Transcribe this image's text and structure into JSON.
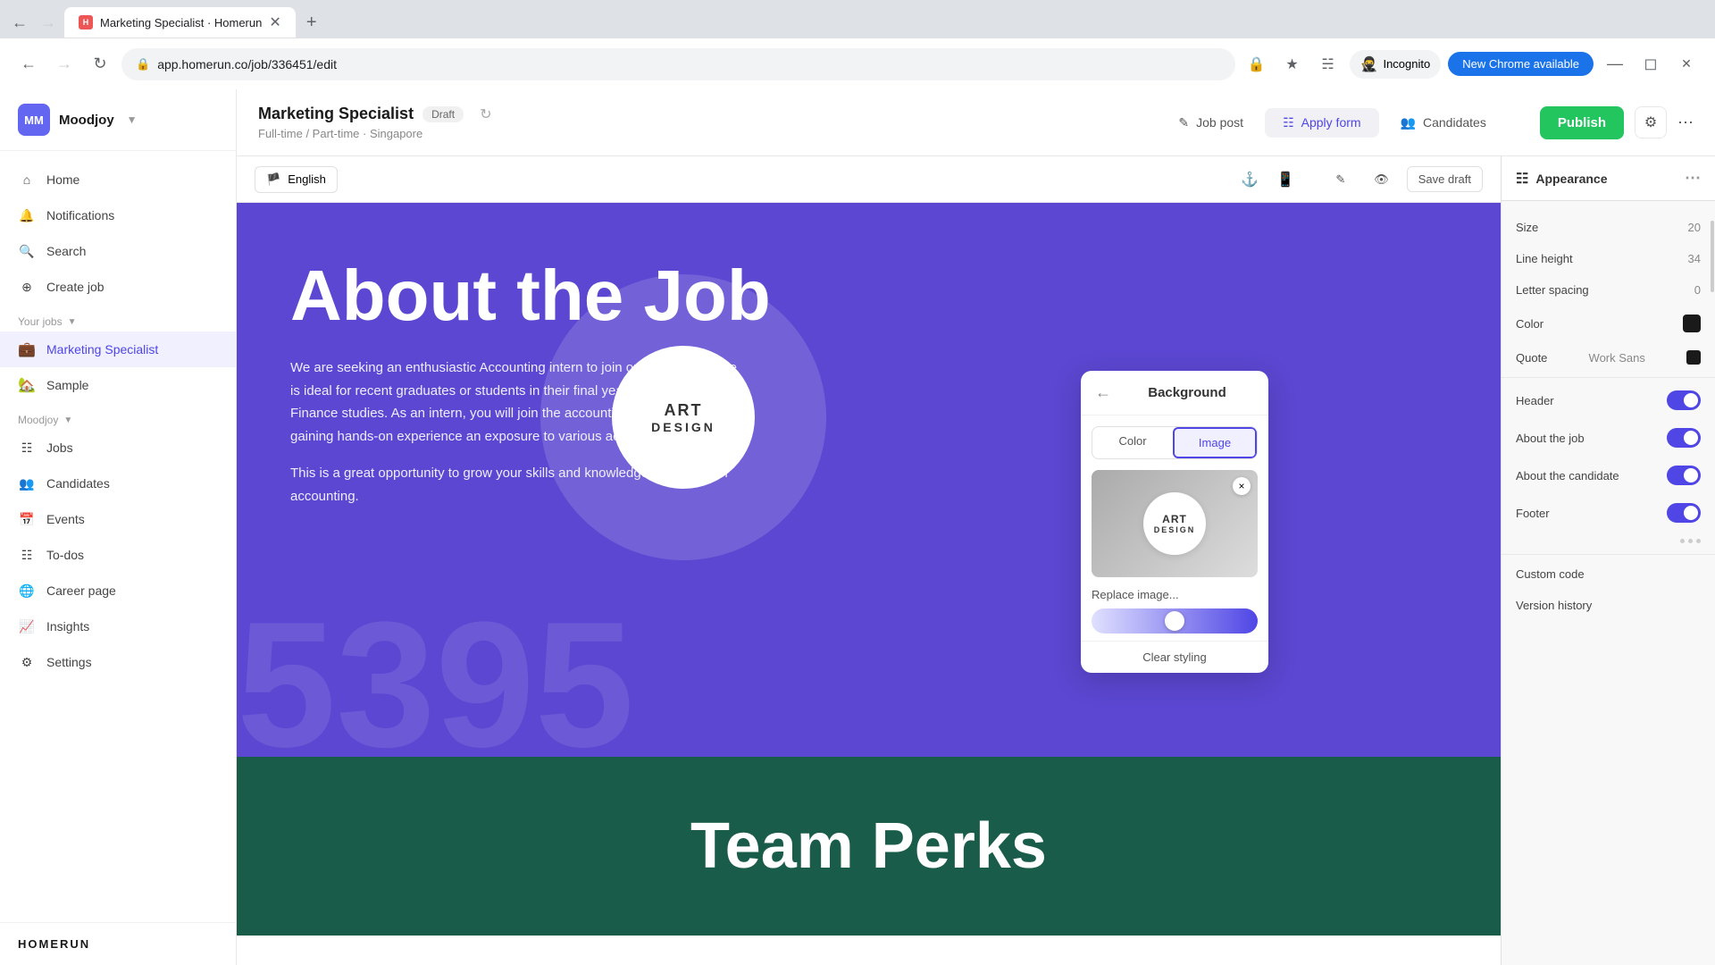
{
  "browser": {
    "tab_title": "Marketing Specialist · Homerun",
    "url": "app.homerun.co/job/336451/edit",
    "new_chrome_label": "New Chrome available",
    "incognito_label": "Incognito"
  },
  "sidebar": {
    "company_initials": "MM",
    "company_name": "Moodjoy",
    "nav_items": [
      {
        "label": "Home",
        "icon": "home"
      },
      {
        "label": "Notifications",
        "icon": "bell"
      },
      {
        "label": "Search",
        "icon": "search"
      },
      {
        "label": "Create job",
        "icon": "plus"
      }
    ],
    "your_jobs_label": "Your jobs",
    "jobs": [
      {
        "label": "Marketing Specialist",
        "active": true
      },
      {
        "label": "Sample"
      }
    ],
    "moodjoy_label": "Moodjoy",
    "moodjoy_nav": [
      {
        "label": "Jobs"
      },
      {
        "label": "Candidates"
      },
      {
        "label": "Events"
      },
      {
        "label": "To-dos"
      },
      {
        "label": "Career page"
      },
      {
        "label": "Insights"
      },
      {
        "label": "Settings"
      }
    ],
    "footer_logo": "HOMERUN"
  },
  "header": {
    "job_title": "Marketing Specialist",
    "draft_label": "Draft",
    "job_meta": "Full-time / Part-time · Singapore",
    "tabs": [
      {
        "label": "Job post",
        "icon": "edit"
      },
      {
        "label": "Apply form",
        "icon": "list"
      },
      {
        "label": "Candidates",
        "icon": "person"
      }
    ],
    "publish_label": "Publish",
    "save_draft_label": "Save draft"
  },
  "preview_toolbar": {
    "lang_label": "English",
    "desktop_label": "desktop",
    "mobile_label": "mobile",
    "edit_label": "edit",
    "preview_label": "preview",
    "save_draft_label": "Save draft"
  },
  "preview": {
    "section_tag": "",
    "about_title": "About the Job",
    "description_1": "We are seeking an enthusiastic Accounting intern to join our entry-level role is ideal for recent graduates or students in their final year of Accounting & Finance studies. As an intern, you will join the accounting department, gaining hands-on experience an exposure to various accounting tasks.",
    "description_2": "This is a great opportunity to grow your skills and knowledge in the field of accounting.",
    "team_perks_title": "Team Perks",
    "big_bg_text": "5395"
  },
  "appearance": {
    "header_label": "Appearance",
    "rows": [
      {
        "label": "Size",
        "value": "20"
      },
      {
        "label": "Line height",
        "value": "34"
      },
      {
        "label": "Letter spacing",
        "value": "0"
      },
      {
        "label": "Color",
        "value": ""
      },
      {
        "label": "Quote",
        "value": "Work Sans"
      }
    ],
    "toggles": [
      {
        "label": "Header",
        "on": true
      },
      {
        "label": "About the job",
        "on": true
      },
      {
        "label": "About the candidate",
        "on": true
      },
      {
        "label": "Footer",
        "on": true
      }
    ],
    "more_items": [
      {
        "label": "Custom code"
      },
      {
        "label": "Version history"
      }
    ]
  },
  "background_popup": {
    "title": "Background",
    "back_label": "←",
    "tab_color": "Color",
    "tab_image": "Image",
    "replace_label": "Replace image...",
    "clear_label": "Clear styling",
    "close_label": "×"
  }
}
